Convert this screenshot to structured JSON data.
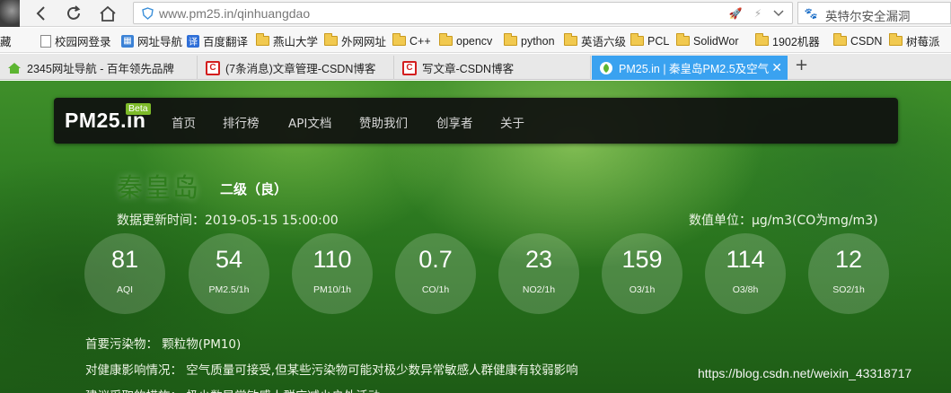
{
  "browser": {
    "url": "www.pm25.in/qinhuangdao",
    "search_text": "英特尔安全漏洞",
    "bookmarks": [
      {
        "label": "藏",
        "icon": "none"
      },
      {
        "label": "校园网登录",
        "icon": "page-icon"
      },
      {
        "label": "网址导航",
        "icon": "nav-icon"
      },
      {
        "label": "百度翻译",
        "icon": "translate-icon"
      },
      {
        "label": "燕山大学",
        "icon": "folder-icon"
      },
      {
        "label": "外网网址",
        "icon": "folder-icon"
      },
      {
        "label": "C++",
        "icon": "folder-icon"
      },
      {
        "label": "opencv",
        "icon": "folder-icon"
      },
      {
        "label": "python",
        "icon": "folder-icon"
      },
      {
        "label": "英语六级",
        "icon": "folder-icon"
      },
      {
        "label": "PCL",
        "icon": "folder-icon"
      },
      {
        "label": "SolidWor",
        "icon": "folder-icon"
      },
      {
        "label": "1902机器",
        "icon": "folder-icon"
      },
      {
        "label": "CSDN",
        "icon": "folder-icon"
      },
      {
        "label": "树莓派",
        "icon": "folder-icon"
      }
    ],
    "tabs": [
      {
        "label": "2345网址导航 - 百年领先品牌",
        "active": false,
        "icon": "house-icon"
      },
      {
        "label": "(7条消息)文章管理-CSDN博客",
        "active": false,
        "icon": "csdn-icon"
      },
      {
        "label": "写文章-CSDN博客",
        "active": false,
        "icon": "csdn-icon"
      },
      {
        "label": "PM25.in | 秦皇岛PM2.5及空气",
        "active": true,
        "icon": "pm25-icon"
      }
    ]
  },
  "site": {
    "brand": "PM25.in",
    "beta": "Beta",
    "nav": [
      "首页",
      "排行榜",
      "API文档",
      "赞助我们",
      "创享者",
      "关于"
    ]
  },
  "city": {
    "name": "秦皇岛",
    "grade": "二级（良）",
    "updated": "数据更新时间：2019-05-15 15:00:00",
    "units": "数值单位：μg/m3(CO为mg/m3)"
  },
  "metrics": [
    {
      "value": "81",
      "label": "AQI"
    },
    {
      "value": "54",
      "label": "PM2.5/1h"
    },
    {
      "value": "110",
      "label": "PM10/1h"
    },
    {
      "value": "0.7",
      "label": "CO/1h"
    },
    {
      "value": "23",
      "label": "NO2/1h"
    },
    {
      "value": "159",
      "label": "O3/1h"
    },
    {
      "value": "114",
      "label": "O3/8h"
    },
    {
      "value": "12",
      "label": "SO2/1h"
    }
  ],
  "info": {
    "primary_pollutant": "首要污染物：   颗粒物(PM10)",
    "health_impact": "对健康影响情况：  空气质量可接受,但某些污染物可能对极少数异常敏感人群健康有较弱影响",
    "advice": "建议采取的措施：  极少数异常敏感人群应减少户外活动"
  },
  "watermark": "https://blog.csdn.net/weixin_43318717",
  "colors": {
    "active_tab": "#3aa2f0",
    "beta_badge": "#7dbb29",
    "city_name": "#2e7d1c"
  }
}
